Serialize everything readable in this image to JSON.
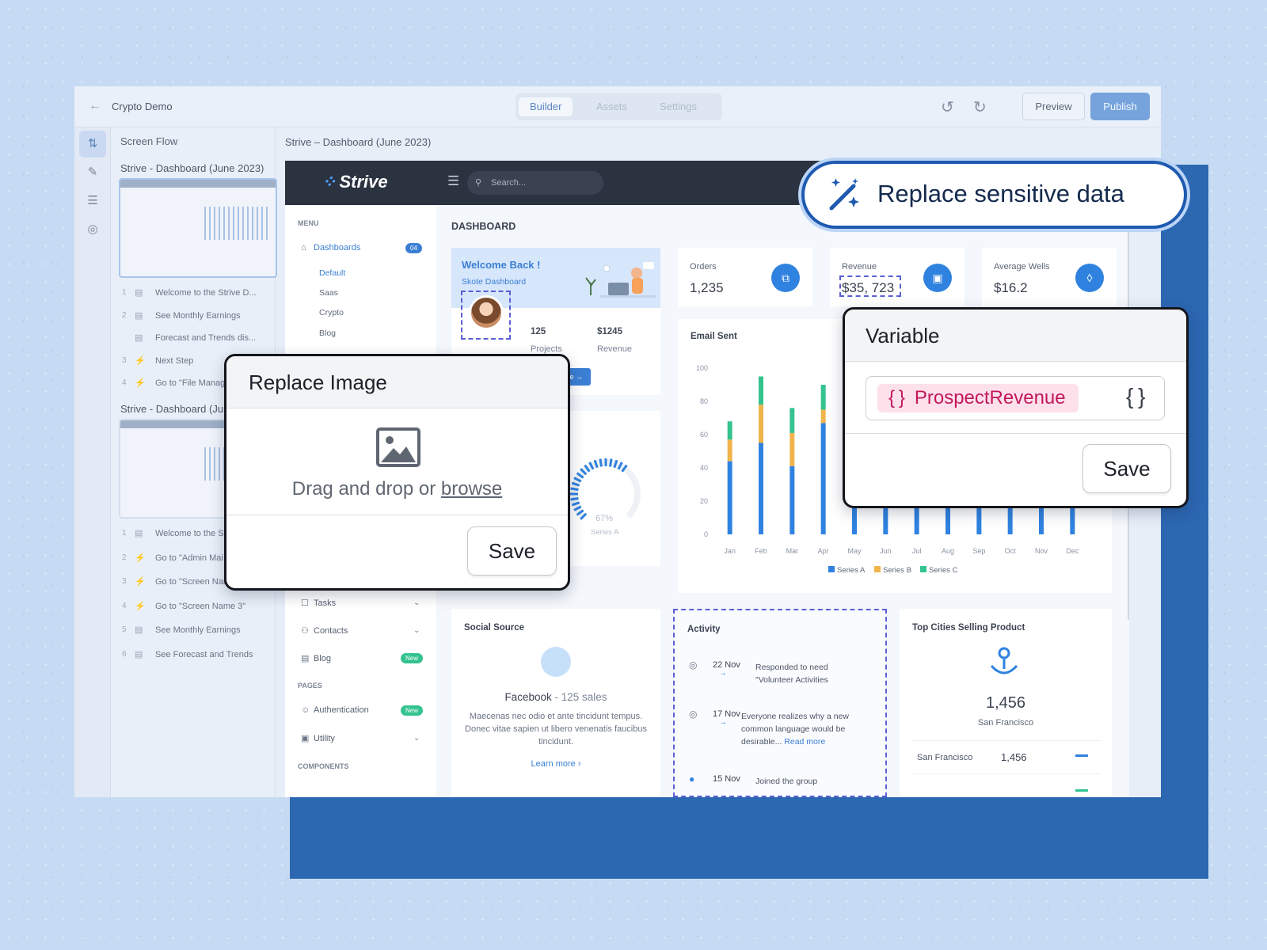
{
  "builder": {
    "app_name": "Crypto Demo",
    "tabs": [
      "Builder",
      "Assets",
      "Settings"
    ],
    "preview_label": "Preview",
    "publish_label": "Publish"
  },
  "flow": {
    "header": "Screen Flow",
    "section1_title": "Strive - Dashboard (June 2023)",
    "section1_steps": [
      {
        "n": "1",
        "label": "Welcome to the Strive D..."
      },
      {
        "n": "2",
        "label": "See Monthly Earnings"
      },
      {
        "n": "",
        "label": "Forecast and Trends dis..."
      },
      {
        "n": "3",
        "label": "Next Step"
      },
      {
        "n": "4",
        "label": "Go to \"File Manag"
      }
    ],
    "section2_title": "Strive - Dashboard (Ju",
    "section2_steps": [
      {
        "n": "1",
        "label": "Welcome to the St"
      },
      {
        "n": "2",
        "label": "Go to \"Admin Mai"
      },
      {
        "n": "3",
        "label": "Go to \"Screen Name 3\"",
        "more": "..."
      },
      {
        "n": "4",
        "label": "Go to \"Screen Name 3\""
      },
      {
        "n": "5",
        "label": "See Monthly Earnings"
      },
      {
        "n": "6",
        "label": "See Forecast and Trends"
      }
    ]
  },
  "canvas": {
    "breadcrumb": "Strive – Dashboard (June 2023)"
  },
  "dashboard": {
    "brand": "Strive",
    "search_placeholder": "Search...",
    "menu_label": "MENU",
    "nav_dashboards": "Dashboards",
    "nav_dashboards_badge": "04",
    "sub_items": [
      "Default",
      "Saas",
      "Crypto",
      "Blog"
    ],
    "nav_tasks": "Tasks",
    "nav_contacts": "Contacts",
    "nav_blog": "Blog",
    "badge_new": "New",
    "pages_label": "PAGES",
    "nav_authentication": "Authentication",
    "nav_utility": "Utility",
    "components_label": "COMPONENTS",
    "page_title": "DASHBOARD",
    "welcome_title": "Welcome Back !",
    "welcome_sub": "Skote Dashboard",
    "projects_value": "125",
    "projects_label": "Projects",
    "revenue_value": "$1245",
    "revenue_label": "Revenue",
    "view_profile": "ofile",
    "gauge_pct": "67%",
    "gauge_value": 0.67,
    "gauge_series": "Series A",
    "stats": [
      {
        "label": "Orders",
        "value": "1,235",
        "icon": "copy-icon"
      },
      {
        "label": "Revenue",
        "value": "$35, 723",
        "icon": "archive-icon"
      },
      {
        "label": "Average Wells",
        "value": "$16.2",
        "icon": "tag-icon"
      }
    ],
    "social_title": "Social Source",
    "social_headline": "Facebook",
    "social_sales": "- 125 sales",
    "social_text": "Maecenas nec odio et ante tincidunt tempus. Donec vitae sapien ut libero venenatis faucibus tincidunt.",
    "social_link": "Learn more",
    "activity_title": "Activity",
    "activity": [
      {
        "date": "22 Nov",
        "text": "Responded to need \"Volunteer Activities"
      },
      {
        "date": "17 Nov",
        "text": "Everyone realizes why a new common language would be desirable...",
        "link": "Read more"
      },
      {
        "date": "15 Nov",
        "text": "Joined the group"
      }
    ],
    "cities_title": "Top Cities Selling Product",
    "cities_big_value": "1,456",
    "cities_big_label": "San Francisco",
    "cities_rows": [
      {
        "city": "San Francisco",
        "value": "1,456"
      }
    ]
  },
  "chart_data": {
    "type": "bar",
    "title": "Email Sent",
    "categories": [
      "Jan",
      "Feb",
      "Mar",
      "Apr",
      "May",
      "Jun",
      "Jul",
      "Aug",
      "Sep",
      "Oct",
      "Nov",
      "Dec"
    ],
    "series": [
      {
        "name": "Series A",
        "color": "#2f82e0",
        "values": [
          44,
          55,
          41,
          67,
          22,
          43,
          36,
          52,
          24,
          18,
          36,
          48
        ]
      },
      {
        "name": "Series B",
        "color": "#f1b44c",
        "values": [
          13,
          23,
          20,
          8,
          13,
          27,
          18,
          22,
          10,
          16,
          24,
          22
        ]
      },
      {
        "name": "Series C",
        "color": "#34c38f",
        "values": [
          11,
          17,
          15,
          15,
          21,
          14,
          11,
          18,
          17,
          12,
          20,
          18
        ]
      }
    ],
    "yticks": [
      0,
      20,
      40,
      60,
      80,
      100
    ],
    "ylim": [
      0,
      100
    ],
    "legend": "bottom"
  },
  "overlays": {
    "pill_text": "Replace sensitive data",
    "replace_image_title": "Replace Image",
    "replace_image_text": "Drag and drop or",
    "replace_image_link": "browse",
    "save_label": "Save",
    "variable_title": "Variable",
    "variable_name": "ProspectRevenue",
    "variable_save": "Save"
  }
}
